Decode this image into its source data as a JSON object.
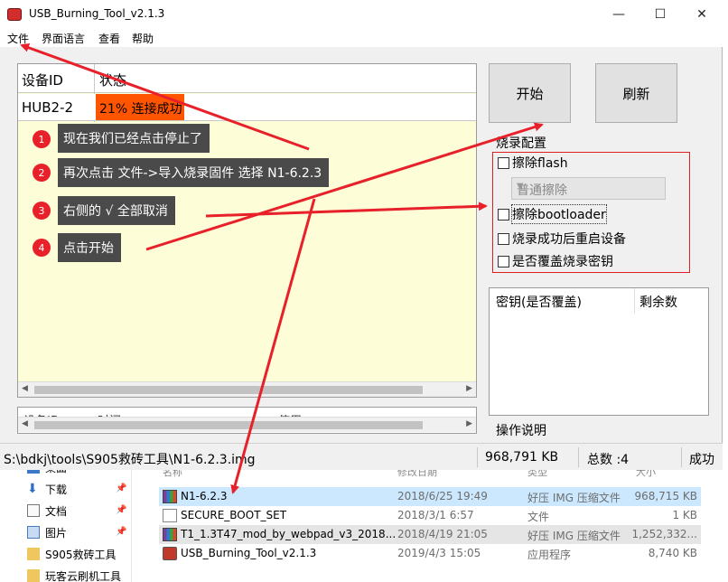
{
  "window": {
    "title": "USB_Burning_Tool_v2.1.3",
    "minimize": "—",
    "maximize": "☐",
    "close": "✕"
  },
  "menu": [
    "文件",
    "界面语言",
    "查看",
    "帮助"
  ],
  "device_grid": {
    "col_device": "设备ID",
    "col_status": "状态",
    "row": {
      "device": "HUB2-2",
      "status": "21% 连接成功"
    }
  },
  "log_grid": {
    "col_device": "设备ID",
    "col_time": "时间",
    "col_user": "使用"
  },
  "buttons": {
    "start": "开始",
    "refresh": "刷新"
  },
  "burn_config": {
    "title": "烧录配置",
    "erase_flash": "擦除flash",
    "erase_mode": "普通擦除",
    "erase_bootloader": "擦除bootloader",
    "reboot_after": "烧录成功后重启设备",
    "overwrite_key": "是否覆盖烧录密钥"
  },
  "key_panel": {
    "col_key": "密钥(是否覆盖)",
    "col_remaining": "剩余数"
  },
  "ops_title": "操作说明",
  "statusbar": {
    "path": "S:\\bdkj\\tools\\S905救砖工具\\N1-6.2.3.img",
    "size": "968,791 KB",
    "total": "总数 :4",
    "success": "成功"
  },
  "annotations": [
    {
      "num": "1",
      "text": "现在我们已经点击停止了"
    },
    {
      "num": "2",
      "text": "再次点击 文件->导入烧录固件 选择 N1-6.2.3"
    },
    {
      "num": "3",
      "text": "右侧的 √ 全部取消"
    },
    {
      "num": "4",
      "text": "点击开始"
    }
  ],
  "explorer": {
    "headers": {
      "name": "名称",
      "date": "修改日期",
      "type": "类型",
      "size": "大小"
    },
    "nav": [
      {
        "label": "桌面",
        "icon": "desktop-icon"
      },
      {
        "label": "下载",
        "icon": "download-icon"
      },
      {
        "label": "文档",
        "icon": "document-icon"
      },
      {
        "label": "图片",
        "icon": "picture-icon"
      },
      {
        "label": "S905救砖工具",
        "icon": "folder-icon"
      },
      {
        "label": "玩客云刷机工具",
        "icon": "folder-icon"
      }
    ],
    "files": [
      {
        "name": "N1-6.2.3",
        "date": "2018/6/25 19:49",
        "type": "好压 IMG 压缩文件",
        "size": "968,715 KB",
        "icon": "rar-icon"
      },
      {
        "name": "SECURE_BOOT_SET",
        "date": "2018/3/1 6:57",
        "type": "文件",
        "size": "1 KB",
        "icon": "file-icon"
      },
      {
        "name": "T1_1.3T47_mod_by_webpad_v3_2018...",
        "date": "2018/4/19 21:05",
        "type": "好压 IMG 压缩文件",
        "size": "1,252,332...",
        "icon": "rar-icon"
      },
      {
        "name": "USB_Burning_Tool_v2.1.3",
        "date": "2019/4/3 15:05",
        "type": "应用程序",
        "size": "8,740 KB",
        "icon": "app-icon"
      }
    ]
  },
  "colors": {
    "status_progress": "#ff5500",
    "annotation_bg": "#4a4a4a",
    "annotation_badge": "#e8202a",
    "arrow": "#e8202a",
    "grid_bg": "#fdfdd8"
  }
}
